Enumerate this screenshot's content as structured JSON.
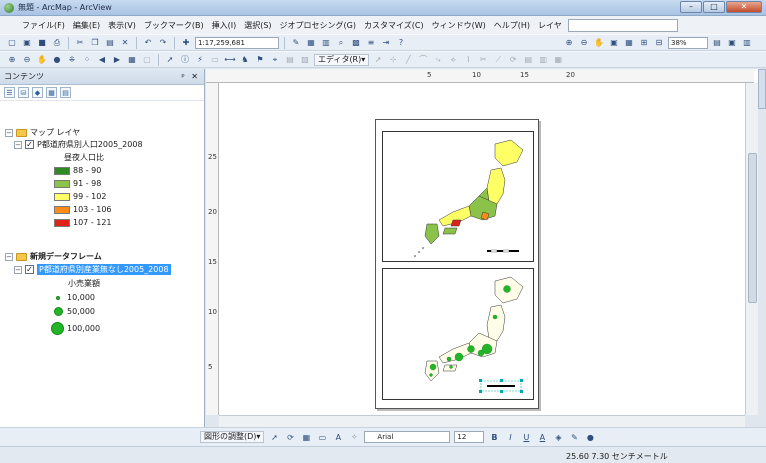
{
  "window": {
    "title": "無題 - ArcMap - ArcView",
    "controls": [
      "–",
      "□",
      "✕"
    ]
  },
  "menu": {
    "items": [
      "ファイル(F)",
      "編集(E)",
      "表示(V)",
      "ブックマーク(B)",
      "挿入(I)",
      "選択(S)",
      "ジオプロセシング(G)",
      "カスタマイズ(C)",
      "ウィンドウ(W)",
      "ヘルプ(H)",
      "レイヤ"
    ]
  },
  "toolbar": {
    "scale": "1:17,259,681",
    "editor_label": "エディタ(R)▾",
    "zoom_percent": "38%"
  },
  "toc": {
    "title": "コンテンツ",
    "close_label": "✕",
    "pin_label": "ᵖ",
    "frame1": {
      "name": "マップ レイヤ",
      "layer": "P都道府県別人口2005_2008",
      "field": "昼夜人口比",
      "classes": [
        {
          "label": "88 - 90",
          "color": "#2e8b1f"
        },
        {
          "label": "91 - 98",
          "color": "#8bc34a"
        },
        {
          "label": "99 - 102",
          "color": "#ffff66"
        },
        {
          "label": "103 - 106",
          "color": "#ff8c1a"
        },
        {
          "label": "107 - 121",
          "color": "#e0231a"
        }
      ]
    },
    "frame2": {
      "name": "新規データフレーム",
      "layer": "P都道府県別産業無なし2005_2008",
      "field": "小売業額",
      "classes": [
        {
          "label": "10,000"
        },
        {
          "label": "50,000"
        },
        {
          "label": "100,000"
        }
      ]
    }
  },
  "ruler": {
    "top_ticks": [
      "5",
      "10",
      "15",
      "20"
    ],
    "left_ticks": [
      "25",
      "20",
      "15",
      "10",
      "5"
    ]
  },
  "drawbar": {
    "drawing_label": "図形の調整(D)▾",
    "font": "Arial",
    "size": "12",
    "bold": "B",
    "italic": "I",
    "underline": "U",
    "font_color_label": "A"
  },
  "status": {
    "coords": "25.60  7.30 センチメートル"
  }
}
